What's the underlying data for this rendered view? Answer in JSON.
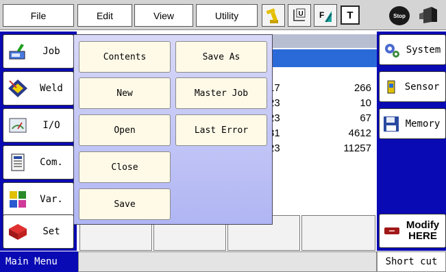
{
  "menu": {
    "file": "File",
    "edit": "Edit",
    "view": "View",
    "utility": "Utility",
    "t_label": "T",
    "stop_label": "Stop",
    "u_label": "U",
    "f_label": "F"
  },
  "left_nav": [
    {
      "label": "Job",
      "icon": "job-icon"
    },
    {
      "label": "Weld",
      "icon": "weld-icon"
    },
    {
      "label": "I/O",
      "icon": "io-gauge-icon"
    },
    {
      "label": "Com.",
      "icon": "communication-icon"
    },
    {
      "label": "Var.",
      "icon": "variable-icon"
    },
    {
      "label": "Set",
      "icon": "set-icon"
    }
  ],
  "right_nav": {
    "system": "System",
    "sensor": "Sensor",
    "memory": "Memory",
    "modify": "Modify",
    "here": "HERE"
  },
  "popup": {
    "contents": "Contents",
    "save_as": "Save As",
    "new": "New",
    "master_job": "Master Job",
    "open": "Open",
    "last_error": "Last Error",
    "close": "Close",
    "save": "Save"
  },
  "table": {
    "left_fragments": [
      "17",
      "23",
      "23",
      "31",
      "23"
    ],
    "right_values": [
      "266",
      "10",
      "67",
      "4612",
      "11257"
    ]
  },
  "status": {
    "main_menu": "Main Menu",
    "short_cut": "Short cut"
  },
  "colors": {
    "nav_blue": "#0a0ab4",
    "highlight_blue": "#2a6ad8",
    "popup_button": "#fffae8"
  }
}
